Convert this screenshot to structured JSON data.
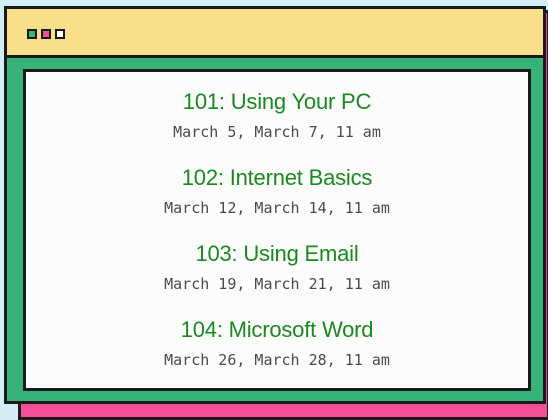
{
  "courses": [
    {
      "title": "101: Using Your PC",
      "dates": "March 5, March 7, 11 am"
    },
    {
      "title": "102: Internet Basics",
      "dates": "March 12, March 14, 11 am"
    },
    {
      "title": "103: Using Email",
      "dates": "March 19, March 21, 11 am"
    },
    {
      "title": "104: Microsoft Word",
      "dates": "March 26, March 28, 11 am"
    }
  ],
  "colors": {
    "background": "#d4eef9",
    "window_frame": "#35b379",
    "back_card": "#f24f97",
    "titlebar": "#f8e08a",
    "course_title": "#1a8a1f",
    "course_dates": "#4a4a4a"
  },
  "titlebar_controls": [
    "green-square-icon",
    "pink-square-icon",
    "white-square-icon"
  ]
}
